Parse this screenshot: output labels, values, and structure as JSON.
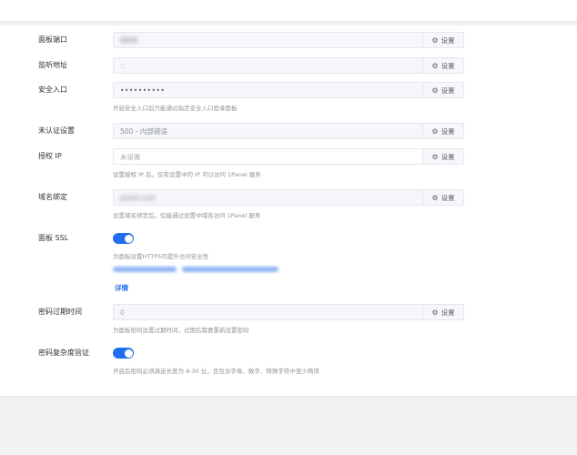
{
  "settings": {
    "port": {
      "label": "面板端口",
      "value": "8888",
      "button": "设置"
    },
    "listen": {
      "label": "监听地址",
      "value": "::",
      "button": "设置"
    },
    "entrance": {
      "label": "安全入口",
      "value": "••••••••••",
      "button": "设置",
      "hint": "开启安全入口后只能通过指定安全入口登录面板"
    },
    "unauth": {
      "label": "未认证设置",
      "value": "500 - 内部错误",
      "button": "设置"
    },
    "allow_ip": {
      "label": "授权 IP",
      "placeholder": "未设置",
      "button": "设置",
      "hint": "设置授权 IP 后，仅有设置中的 IP 可以访问 1Panel 服务"
    },
    "domain": {
      "label": "域名绑定",
      "value": "panel.com",
      "button": "设置",
      "hint": "设置域名绑定后，仅能通过设置中域名访问 1Panel 服务"
    },
    "ssl": {
      "label": "面板 SSL",
      "enabled": true,
      "hint": "为面板设置HTTPS可提升访问安全性",
      "detail": "详情"
    },
    "expiration": {
      "label": "密码过期时间",
      "value": "0",
      "button": "设置",
      "hint": "为面板密码设置过期时间，过期后需要重新设置密码"
    },
    "complexity": {
      "label": "密码复杂度验证",
      "enabled": true,
      "hint": "开启后密码必须满足长度为 8-30 位，且包含字母、数字、特殊字符中至少两项"
    }
  },
  "colors": {
    "accent": "#1f6fef",
    "background": "#f1f2f4"
  },
  "icons": {
    "settings_button": "gear-icon"
  }
}
